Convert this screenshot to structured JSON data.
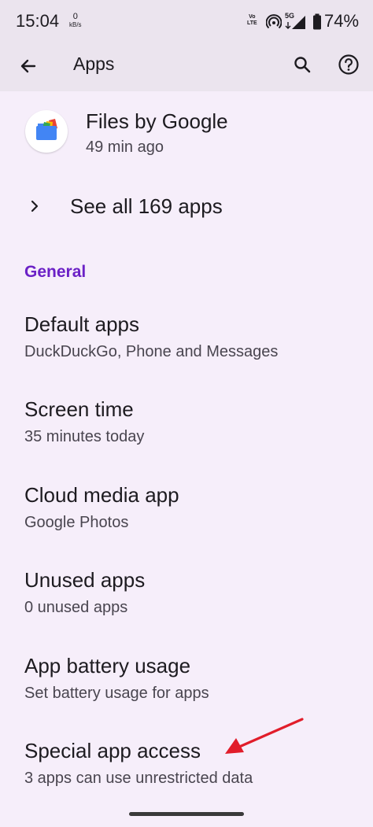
{
  "status_bar": {
    "time": "15:04",
    "net_speed_value": "0",
    "net_speed_unit": "kB/s",
    "volte_top": "Vo",
    "volte_bottom": "LTE",
    "network": "5G",
    "battery": "74%"
  },
  "app_bar": {
    "title": "Apps",
    "back_icon": "arrow-back-icon",
    "search_icon": "search-icon",
    "help_icon": "help-icon"
  },
  "recent_app": {
    "name": "Files by Google",
    "time": "49 min ago"
  },
  "see_all": {
    "label": "See all 169 apps"
  },
  "section": {
    "label": "General"
  },
  "items": [
    {
      "title": "Default apps",
      "subtitle": "DuckDuckGo, Phone and Messages"
    },
    {
      "title": "Screen time",
      "subtitle": "35 minutes today"
    },
    {
      "title": "Cloud media app",
      "subtitle": "Google Photos"
    },
    {
      "title": "Unused apps",
      "subtitle": "0 unused apps"
    },
    {
      "title": "App battery usage",
      "subtitle": "Set battery usage for apps"
    },
    {
      "title": "Special app access",
      "subtitle": "3 apps can use unrestricted data"
    }
  ],
  "colors": {
    "background": "#f6eefa",
    "app_bar": "#ebe4ee",
    "section_accent": "#6b21c6",
    "annotation_arrow": "#e11d2a"
  }
}
